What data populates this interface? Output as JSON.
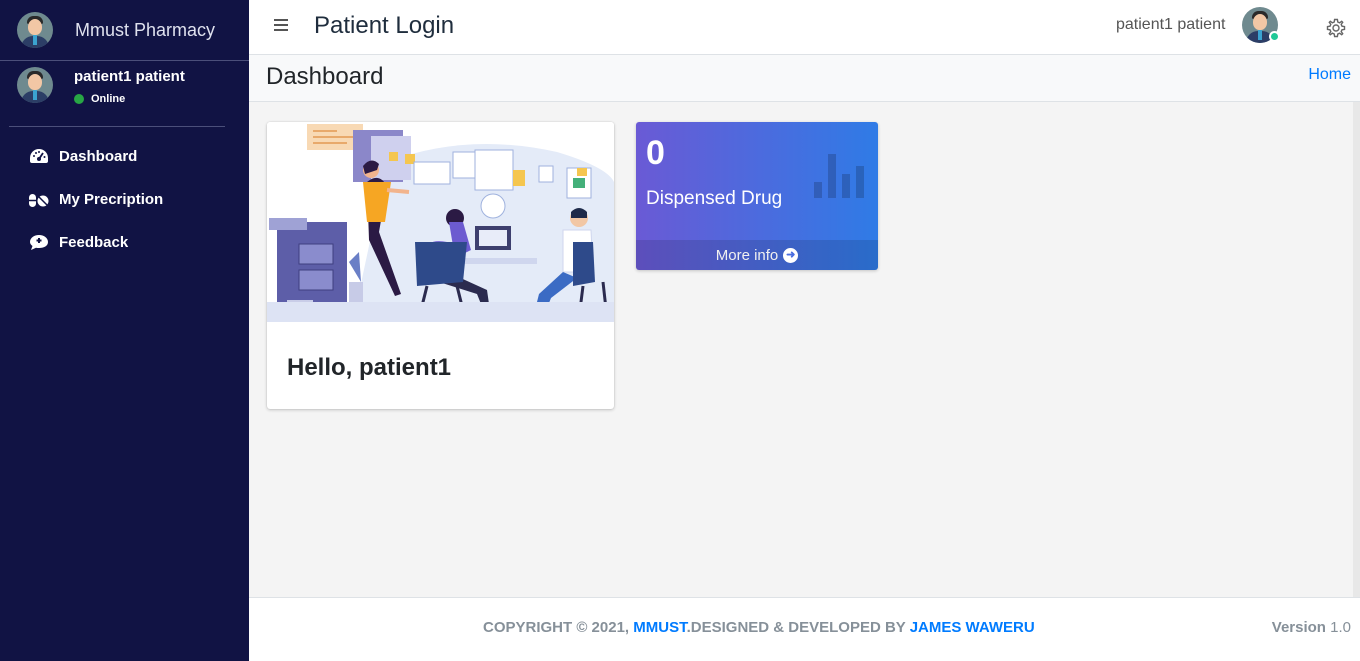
{
  "app": {
    "brand": "Mmust Pharmacy",
    "header_title": "Patient Login"
  },
  "sidebar": {
    "user_name": "patient1 patient",
    "status": "Online",
    "items": [
      {
        "label": "Dashboard",
        "icon": "tachometer-icon"
      },
      {
        "label": "My Precription",
        "icon": "pills-icon"
      },
      {
        "label": "Feedback",
        "icon": "comment-icon"
      }
    ]
  },
  "topbar": {
    "user_name": "patient1 patient"
  },
  "content_header": {
    "title": "Dashboard",
    "breadcrumb": "Home"
  },
  "welcome_card": {
    "greeting": "Hello, patient1"
  },
  "stat_box": {
    "value": "0",
    "label": "Dispensed Drug",
    "link": "More info"
  },
  "footer": {
    "prefix": "COPYRIGHT © 2021, ",
    "org_link": "MMUST",
    "middle": ".DESIGNED & DEVELOPED BY ",
    "author_link": "JAMES WAWERU",
    "version_label": "Version",
    "version_value": "1.0"
  },
  "colors": {
    "sidebar_bg": "#111344",
    "link": "#007bff",
    "online": "#28a745",
    "box_gradient_start": "#6a5ad5",
    "box_gradient_end": "#2f7be6"
  }
}
